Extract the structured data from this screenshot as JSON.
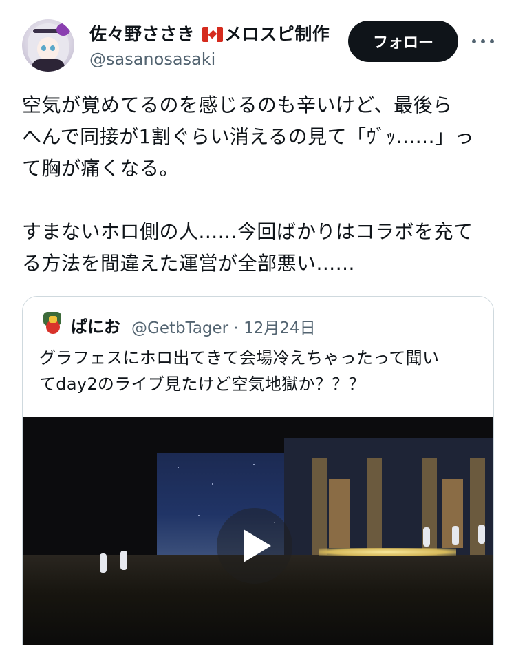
{
  "post": {
    "author": {
      "name_before_flag": "佐々野ささき ",
      "flag_icon": "canada-flag-icon",
      "name_after_flag": "メロスピ制作",
      "handle": "@sasanosasaki"
    },
    "follow_label": "フォロー",
    "more_icon": "more-icon",
    "text": "空気が覚めてるのを感じるのも辛いけど、最後ら\nへんで同接が1割ぐらい消えるの見て「ｳﾞｯ......」っ\nて胸が痛くなる。\n\nすまないホロ側の人......今回ばかりはコラボを充て\nる方法を間違えた運営が全部悪い......"
  },
  "quote": {
    "author": {
      "name": "ぱにお",
      "handle_and_date": "@GetbTager · 12月24日"
    },
    "text": "グラフェスにホロ出てきて会場冷えちゃったって聞い\nてday2のライブ見たけど空気地獄か？？？",
    "video": {
      "play_icon": "play-icon"
    }
  }
}
